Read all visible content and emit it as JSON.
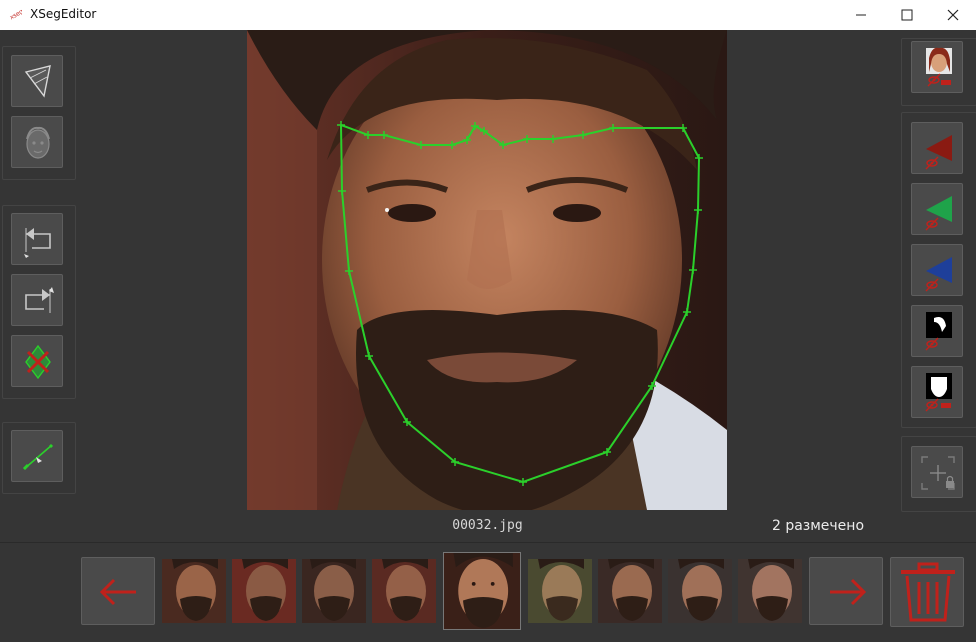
{
  "window": {
    "title": "XSegEditor",
    "app_icon_text": "xseg"
  },
  "viewer": {
    "filename": "00032.jpg",
    "marked_count": "2 размечено"
  },
  "colors": {
    "background": "#353535",
    "button": "#4a4a4a",
    "polygon": "#2bd02b",
    "red_accent": "#c0211b",
    "green_accent": "#1fa34a",
    "blue_accent": "#1e3f9a"
  },
  "filmstrip": {
    "thumbnail_count": 9,
    "current_index": 4
  },
  "icons": {
    "left_tools": [
      "polygon-mode-icon",
      "face-mask-icon",
      "undo-point-icon",
      "redo-point-icon",
      "delete-polygon-icon",
      "edge-edit-icon"
    ],
    "right_tools": [
      "face-preview-icon",
      "red-include-icon",
      "green-exclude-icon",
      "blue-mask-icon",
      "black-white-mask-icon",
      "white-face-mask-icon",
      "add-lock-icon"
    ],
    "navigation": [
      "prev-arrow-icon",
      "next-arrow-icon",
      "trash-icon"
    ]
  }
}
